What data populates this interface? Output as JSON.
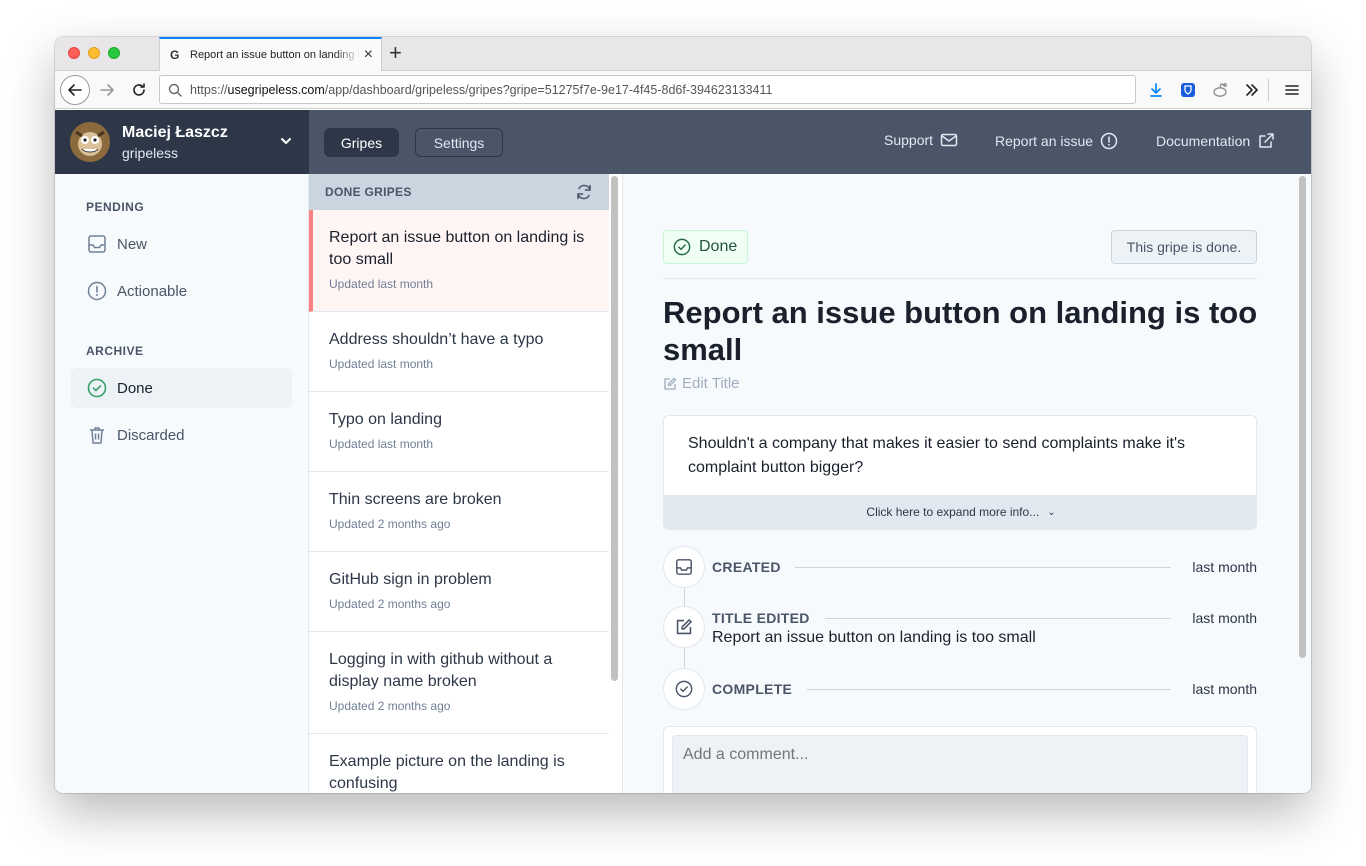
{
  "browser": {
    "tab_title": "Report an issue button on landing is too small",
    "tab_favicon": "G",
    "url_prefix": "https://",
    "url_host": "usegripeless.com",
    "url_path": "/app/dashboard/gripeless/gripes?gripe=51275f7e-9e17-4f45-8d6f-394623133411"
  },
  "account": {
    "name": "Maciej Łaszcz",
    "org": "gripeless"
  },
  "header": {
    "tabs": [
      "Gripes",
      "Settings"
    ],
    "links": [
      {
        "label": "Support",
        "icon": "mail-icon"
      },
      {
        "label": "Report an issue",
        "icon": "alert-circle-icon"
      },
      {
        "label": "Documentation",
        "icon": "external-link-icon"
      }
    ]
  },
  "sidebar": {
    "pending_heading": "PENDING",
    "archive_heading": "ARCHIVE",
    "items": [
      {
        "label": "New",
        "icon": "inbox-icon"
      },
      {
        "label": "Actionable",
        "icon": "alert-circle-icon"
      },
      {
        "label": "Done",
        "icon": "check-circle-icon"
      },
      {
        "label": "Discarded",
        "icon": "trash-icon"
      }
    ]
  },
  "list": {
    "heading": "DONE GRIPES",
    "items": [
      {
        "title": "Report an issue button on landing is too small",
        "meta": "Updated last month"
      },
      {
        "title": "Address shouldn’t have a typo",
        "meta": "Updated last month"
      },
      {
        "title": "Typo on landing",
        "meta": "Updated last month"
      },
      {
        "title": "Thin screens are broken",
        "meta": "Updated 2 months ago"
      },
      {
        "title": "GitHub sign in problem",
        "meta": "Updated 2 months ago"
      },
      {
        "title": "Logging in with github without a display name broken",
        "meta": "Updated 2 months ago"
      },
      {
        "title": "Example picture on the landing is confusing",
        "meta": ""
      }
    ]
  },
  "detail": {
    "status": "Done",
    "status_note": "This gripe is done.",
    "title": "Report an issue button on landing is too small",
    "edit_title": "Edit Title",
    "description": "Shouldn't a company that makes it easier to send complaints make it's complaint button bigger?",
    "expand": "Click here to expand more info...",
    "timeline": [
      {
        "label": "CREATED",
        "time": "last month",
        "icon": "inbox-icon"
      },
      {
        "label": "TITLE EDITED",
        "time": "last month",
        "icon": "edit-icon",
        "detail": "Report an issue button on landing is too small"
      },
      {
        "label": "COMPLETE",
        "time": "last month",
        "icon": "check-circle-icon"
      }
    ],
    "comment_placeholder": "Add a comment..."
  },
  "colors": {
    "header": "#4a5568",
    "account": "#2d3748",
    "active_border": "#fc8181",
    "done_green": "#38a169"
  }
}
